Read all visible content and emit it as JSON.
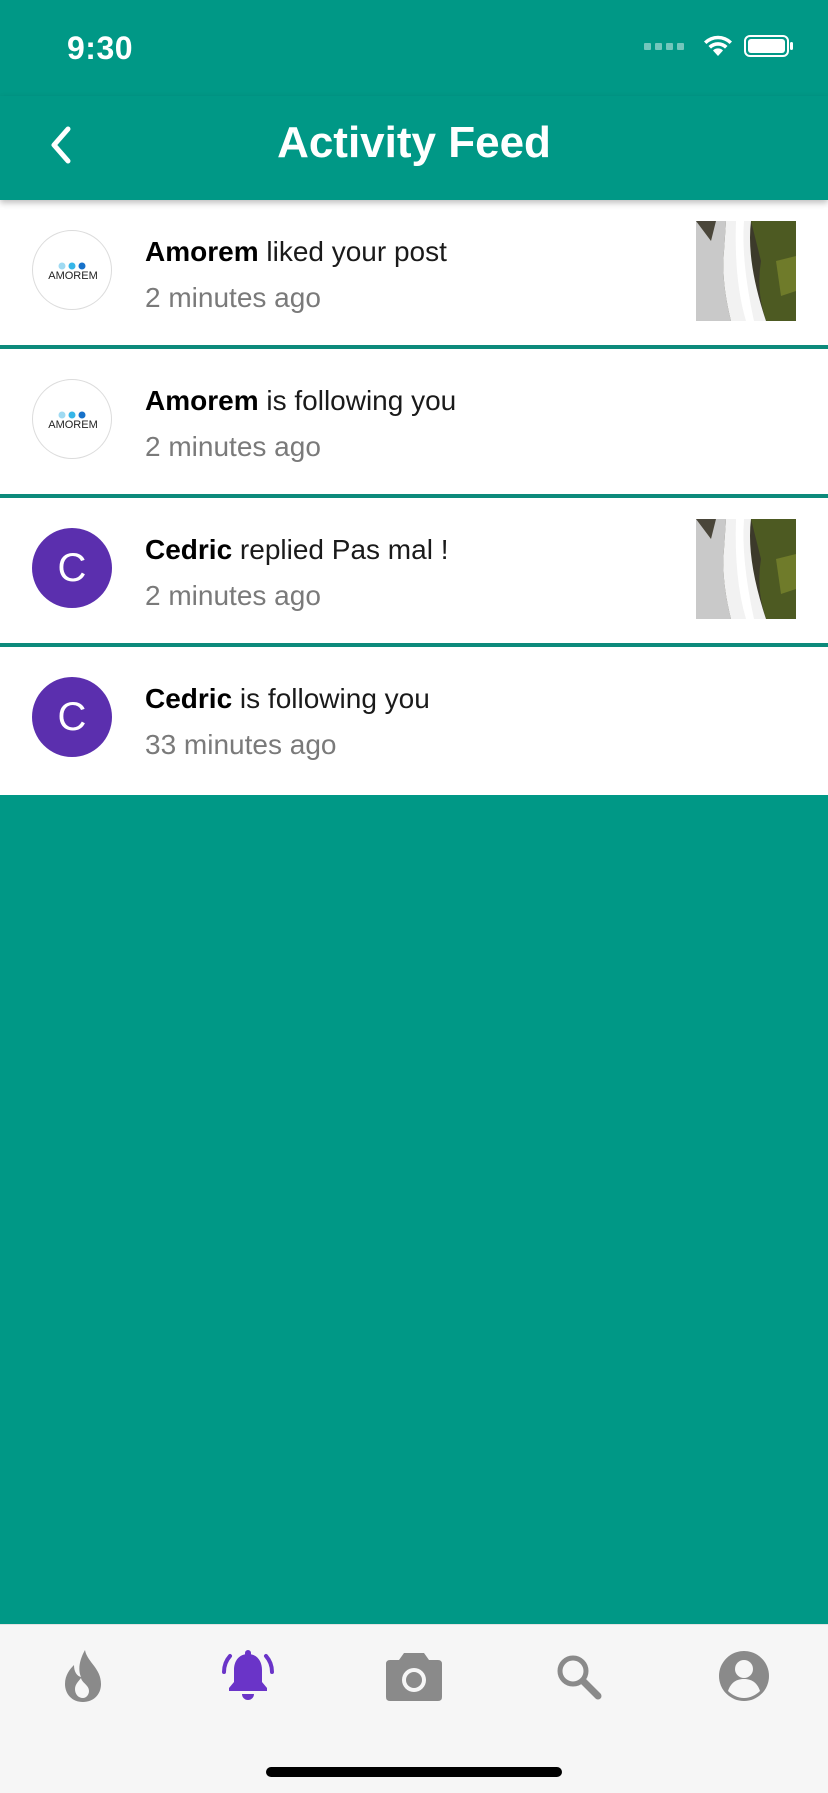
{
  "status_bar": {
    "time": "9:30"
  },
  "header": {
    "title": "Activity Feed",
    "back_icon": "chevron-left-icon"
  },
  "feed": [
    {
      "user": "Amorem",
      "action": " liked your post",
      "time": "2 minutes ago",
      "avatar_type": "amorem-logo",
      "avatar_text": "AMOREM",
      "has_thumbnail": true
    },
    {
      "user": "Amorem",
      "action": " is following you",
      "time": "2 minutes ago",
      "avatar_type": "amorem-logo",
      "avatar_text": "AMOREM",
      "has_thumbnail": false
    },
    {
      "user": "Cedric",
      "action": " replied Pas mal !",
      "time": "2 minutes ago",
      "avatar_type": "letter",
      "avatar_letter": "C",
      "has_thumbnail": true
    },
    {
      "user": "Cedric",
      "action": " is following you",
      "time": "33 minutes ago",
      "avatar_type": "letter",
      "avatar_letter": "C",
      "has_thumbnail": false
    }
  ],
  "tab_bar": {
    "tabs": [
      {
        "icon": "flame-icon",
        "active": false
      },
      {
        "icon": "bell-icon",
        "active": true
      },
      {
        "icon": "camera-icon",
        "active": false
      },
      {
        "icon": "search-icon",
        "active": false
      },
      {
        "icon": "profile-icon",
        "active": false
      }
    ]
  },
  "colors": {
    "primary": "#009886",
    "accent": "#6a34c8",
    "inactive_icon": "#8a8a8a",
    "avatar_purple": "#5b2fae"
  }
}
